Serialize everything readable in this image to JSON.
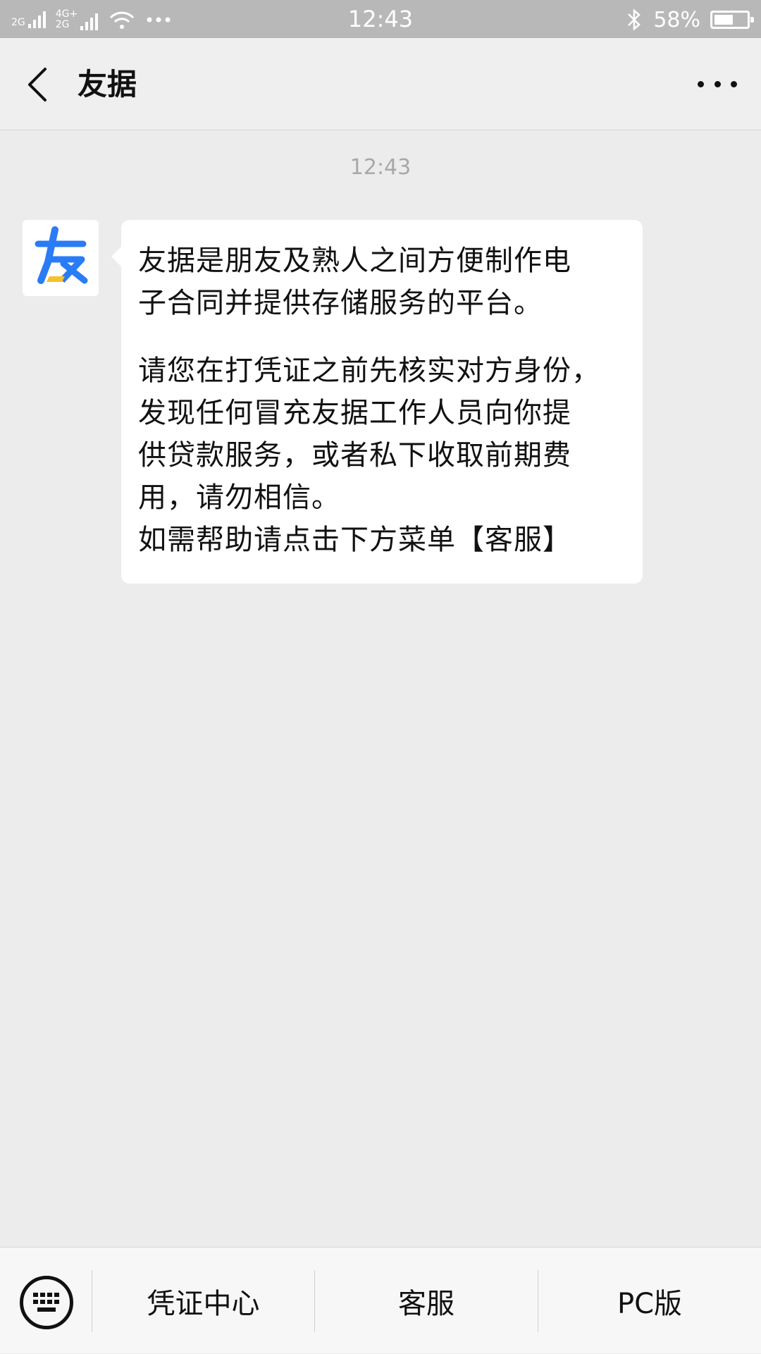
{
  "status_bar": {
    "net1_label": "2G",
    "net2_label_top": "4G+",
    "net2_label_bottom": "2G",
    "time": "12:43",
    "battery_text": "58%",
    "battery_level": 0.58
  },
  "header": {
    "title": "友据",
    "back_icon": "chevron-left-icon",
    "more_icon": "more-dots-icon"
  },
  "chat": {
    "timestamp": "12:43",
    "avatar_icon": "youju-logo",
    "brand_colors": {
      "blue": "#2a7bf6",
      "yellow": "#f6c12a"
    },
    "message": {
      "lines_para1": [
        "友据是朋友及熟人之间方便制作电",
        "子合同并提供存储服务的平台。"
      ],
      "lines_para2": [
        "请您在打凭证之前先核实对方身份，",
        "发现任何冒充友据工作人员向你提",
        "供贷款服务，或者私下收取前期费",
        "用，请勿相信。",
        "如需帮助请点击下方菜单【客服】"
      ]
    }
  },
  "bottom_menu": {
    "keyboard_icon": "keyboard-icon",
    "items": [
      "凭证中心",
      "客服",
      "PC版"
    ]
  }
}
